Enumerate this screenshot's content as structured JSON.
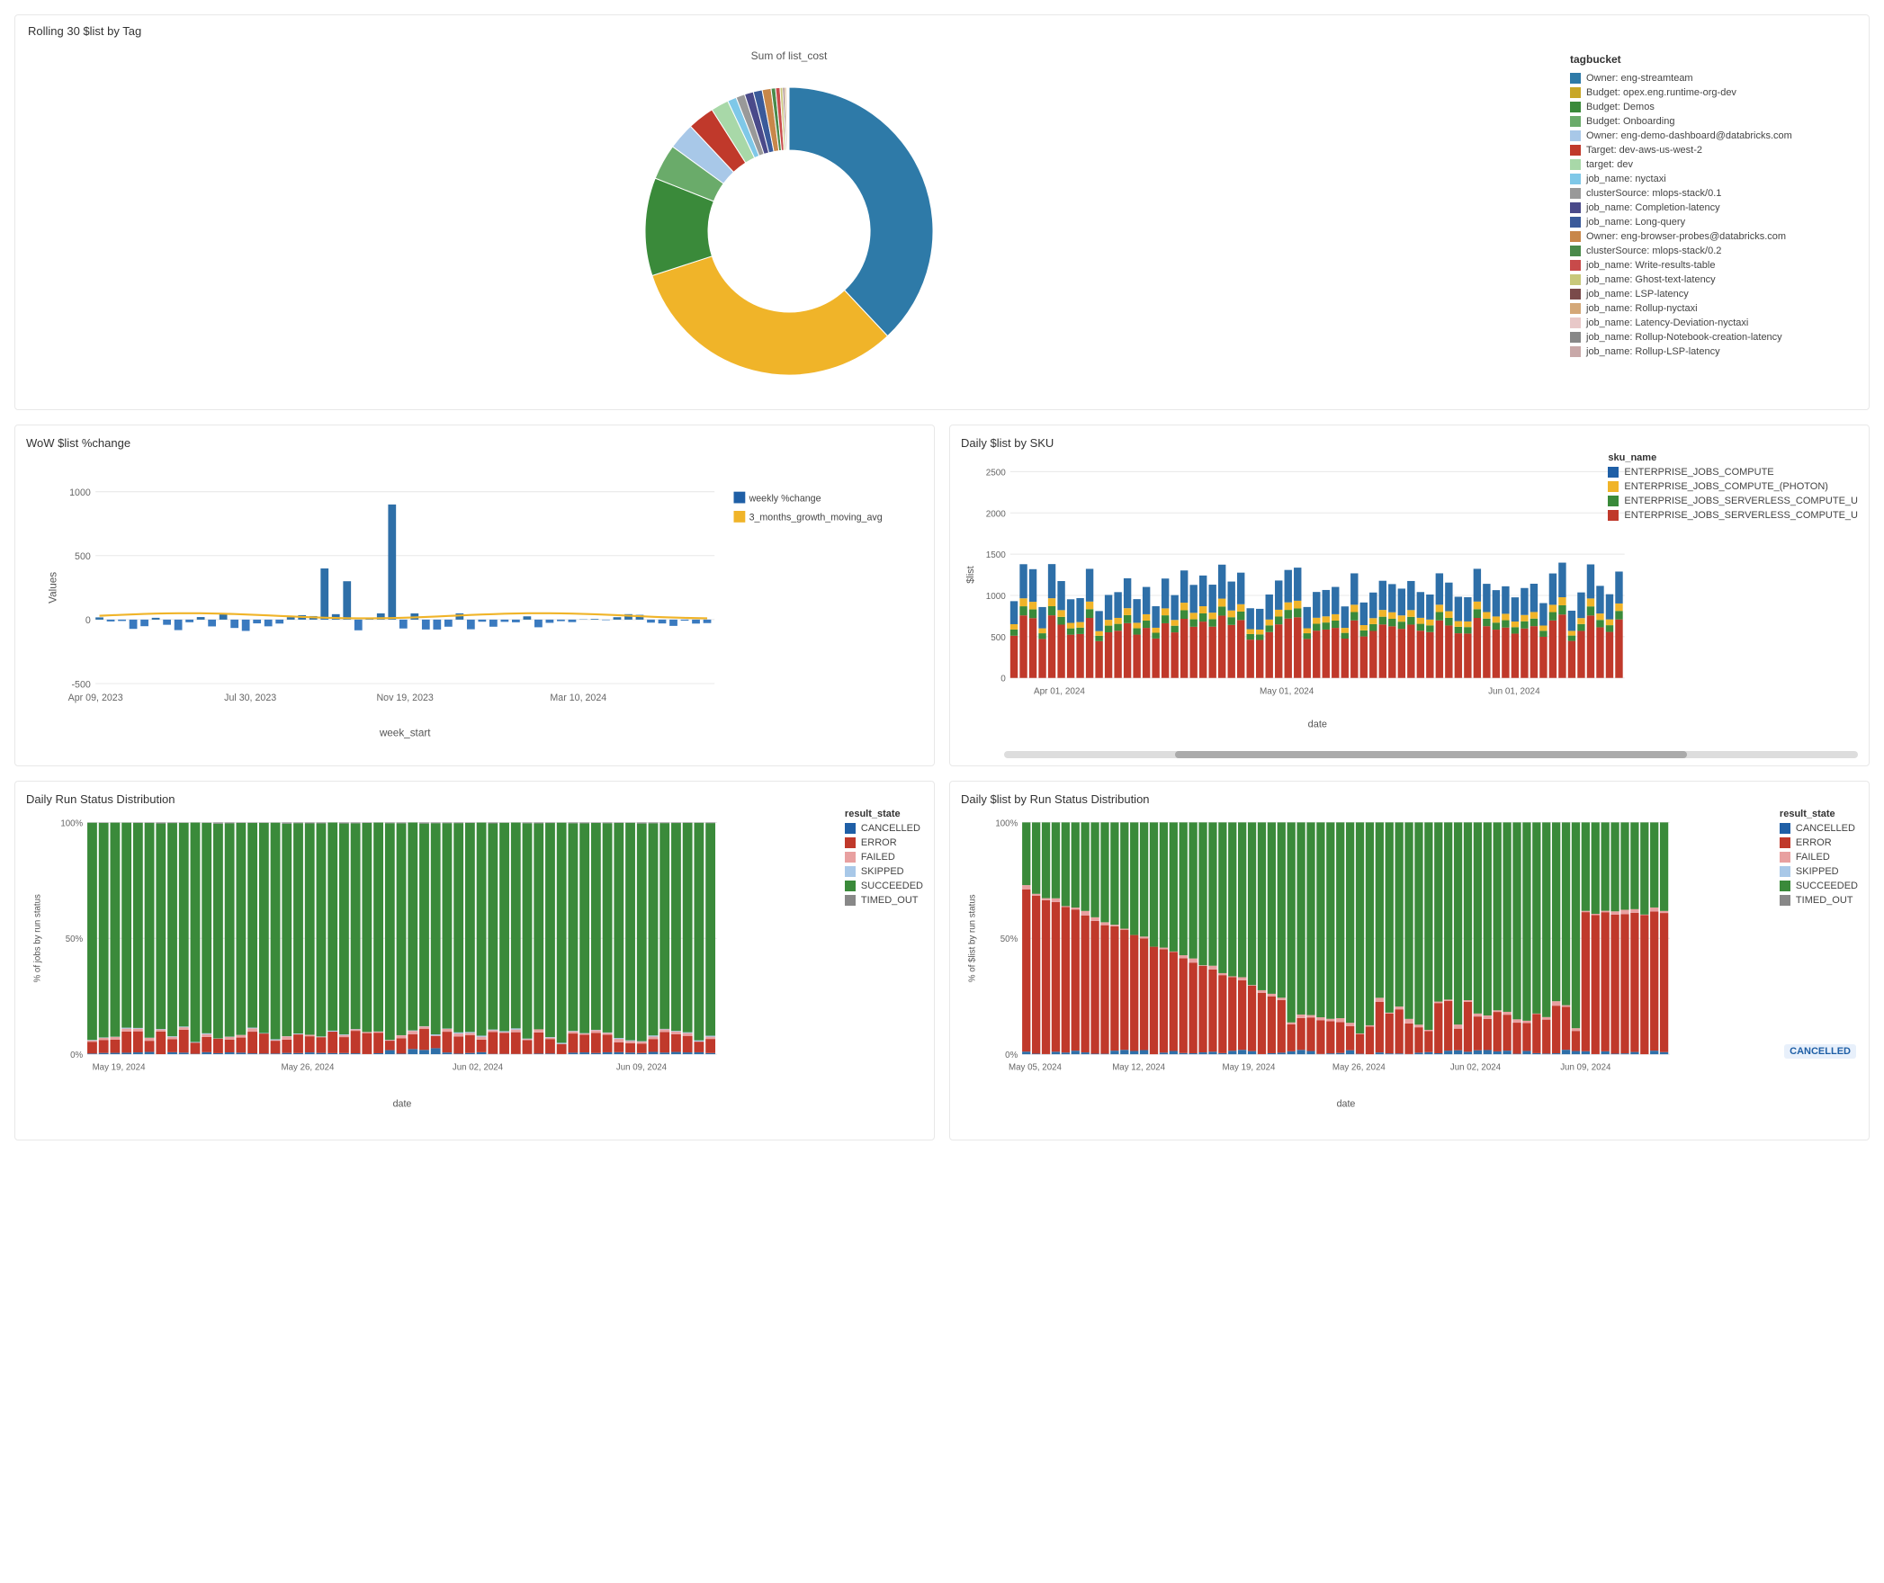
{
  "top": {
    "title": "Rolling 30 $list by Tag",
    "donut_subtitle": "Sum of list_cost",
    "legend_title": "tagbucket",
    "legend_items": [
      {
        "label": "Owner: eng-streamteam",
        "color": "#2e7aa8"
      },
      {
        "label": "Budget: opex.eng.runtime-org-dev",
        "color": "#c8a728"
      },
      {
        "label": "Budget: Demos",
        "color": "#3a8a3a"
      },
      {
        "label": "Budget: Onboarding",
        "color": "#6aab6a"
      },
      {
        "label": "Owner: eng-demo-dashboard@databricks.com",
        "color": "#a8c8e8"
      },
      {
        "label": "Target: dev-aws-us-west-2",
        "color": "#c0392b"
      },
      {
        "label": "target: dev",
        "color": "#a8d8a8"
      },
      {
        "label": "job_name: nyctaxi",
        "color": "#7fc8e8"
      },
      {
        "label": "clusterSource: mlops-stack/0.1",
        "color": "#999"
      },
      {
        "label": "job_name: Completion-latency",
        "color": "#4a4a8a"
      },
      {
        "label": "job_name: Long-query",
        "color": "#3a5a9a"
      },
      {
        "label": "Owner: eng-browser-probes@databricks.com",
        "color": "#c8874a"
      },
      {
        "label": "clusterSource: mlops-stack/0.2",
        "color": "#4a8a4a"
      },
      {
        "label": "job_name: Write-results-table",
        "color": "#c84a4a"
      },
      {
        "label": "job_name: Ghost-text-latency",
        "color": "#c8c87a"
      },
      {
        "label": "job_name: LSP-latency",
        "color": "#7a4a4a"
      },
      {
        "label": "job_name: Rollup-nyctaxi",
        "color": "#d4a878"
      },
      {
        "label": "job_name: Latency-Deviation-nyctaxi",
        "color": "#e8c8c8"
      },
      {
        "label": "job_name: Rollup-Notebook-creation-latency",
        "color": "#888"
      },
      {
        "label": "job_name: Rollup-LSP-latency",
        "color": "#c8a8a8"
      }
    ],
    "donut_segments": [
      {
        "color": "#2e7aa8",
        "pct": 38
      },
      {
        "color": "#f0b429",
        "pct": 32
      },
      {
        "color": "#3a8a3a",
        "pct": 11
      },
      {
        "color": "#6aab6a",
        "pct": 4
      },
      {
        "color": "#a8c8e8",
        "pct": 3
      },
      {
        "color": "#c0392b",
        "pct": 3
      },
      {
        "color": "#a8d8a8",
        "pct": 2
      },
      {
        "color": "#7fc8e8",
        "pct": 1
      },
      {
        "color": "#999",
        "pct": 1
      },
      {
        "color": "#4a4a8a",
        "pct": 1
      },
      {
        "color": "#3a5a9a",
        "pct": 1
      },
      {
        "color": "#c8874a",
        "pct": 1
      },
      {
        "color": "#4a8a4a",
        "pct": 0.5
      },
      {
        "color": "#c84a4a",
        "pct": 0.5
      },
      {
        "color": "#c8c87a",
        "pct": 0.3
      },
      {
        "color": "#7a4a4a",
        "pct": 0.2
      },
      {
        "color": "#d4a878",
        "pct": 0.2
      },
      {
        "color": "#e8c8c8",
        "pct": 0.1
      },
      {
        "color": "#888",
        "pct": 0.1
      },
      {
        "color": "#c8a8a8",
        "pct": 0.1
      }
    ]
  },
  "wow": {
    "title": "WoW $list %change",
    "y_axis_label": "Values",
    "x_axis_label": "week_start",
    "x_ticks": [
      "Apr 09, 2023",
      "Jul 30, 2023",
      "Nov 19, 2023",
      "Mar 10, 2024"
    ],
    "y_ticks": [
      "-500",
      "0",
      "500",
      "1000"
    ],
    "legend": [
      {
        "label": "weekly %change",
        "color": "#1f5fa6"
      },
      {
        "label": "3_months_growth_moving_avg",
        "color": "#f0b429"
      }
    ]
  },
  "daily_sku": {
    "title": "Daily $list by SKU",
    "y_axis_label": "$list",
    "x_axis_label": "date",
    "x_ticks": [
      "Apr 01, 2024",
      "May 01, 2024",
      "Jun 01, 2024"
    ],
    "y_ticks": [
      "0",
      "1000",
      "2000"
    ],
    "legend_title": "sku_name",
    "legend_items": [
      {
        "label": "ENTERPRISE_JOBS_COMPUTE",
        "color": "#1f5fa6"
      },
      {
        "label": "ENTERPRISE_JOBS_COMPUTE_(PHOTON)",
        "color": "#f0b429"
      },
      {
        "label": "ENTERPRISE_JOBS_SERVERLESS_COMPUTE_U",
        "color": "#3a8a3a"
      },
      {
        "label": "ENTERPRISE_JOBS_SERVERLESS_COMPUTE_U",
        "color": "#c0392b"
      }
    ]
  },
  "daily_run_status": {
    "title": "Daily Run Status Distribution",
    "y_axis_label": "% of jobs by run status",
    "x_axis_label": "date",
    "x_ticks": [
      "May 19, 2024",
      "May 26, 2024",
      "Jun 02, 2024",
      "Jun 09, 2024"
    ],
    "y_ticks": [
      "0%",
      "50%",
      "100%"
    ],
    "legend_title": "result_state",
    "legend_items": [
      {
        "label": "CANCELLED",
        "color": "#1f5fa6"
      },
      {
        "label": "ERROR",
        "color": "#c0392b"
      },
      {
        "label": "FAILED",
        "color": "#e8a0a0"
      },
      {
        "label": "SKIPPED",
        "color": "#a8c8e8"
      },
      {
        "label": "SUCCEEDED",
        "color": "#3a8a3a"
      },
      {
        "label": "TIMED_OUT",
        "color": "#888"
      }
    ]
  },
  "daily_list_run_status": {
    "title": "Daily $list by Run Status Distribution",
    "y_axis_label": "% of $list by run status",
    "x_axis_label": "date",
    "x_ticks": [
      "May 05, 2024",
      "May 12, 2024",
      "May 19, 2024",
      "May 26, 2024",
      "Jun 02, 2024",
      "Jun 09, 2024"
    ],
    "y_ticks": [
      "0%",
      "50%",
      "100%"
    ],
    "legend_title": "result_state",
    "legend_items": [
      {
        "label": "CANCELLED",
        "color": "#1f5fa6"
      },
      {
        "label": "ERROR",
        "color": "#c0392b"
      },
      {
        "label": "FAILED",
        "color": "#e8a0a0"
      },
      {
        "label": "SKIPPED",
        "color": "#a8c8e8"
      },
      {
        "label": "SUCCEEDED",
        "color": "#3a8a3a"
      },
      {
        "label": "TIMED_OUT",
        "color": "#888"
      }
    ],
    "cancelled_badge": "CANCELLED"
  }
}
